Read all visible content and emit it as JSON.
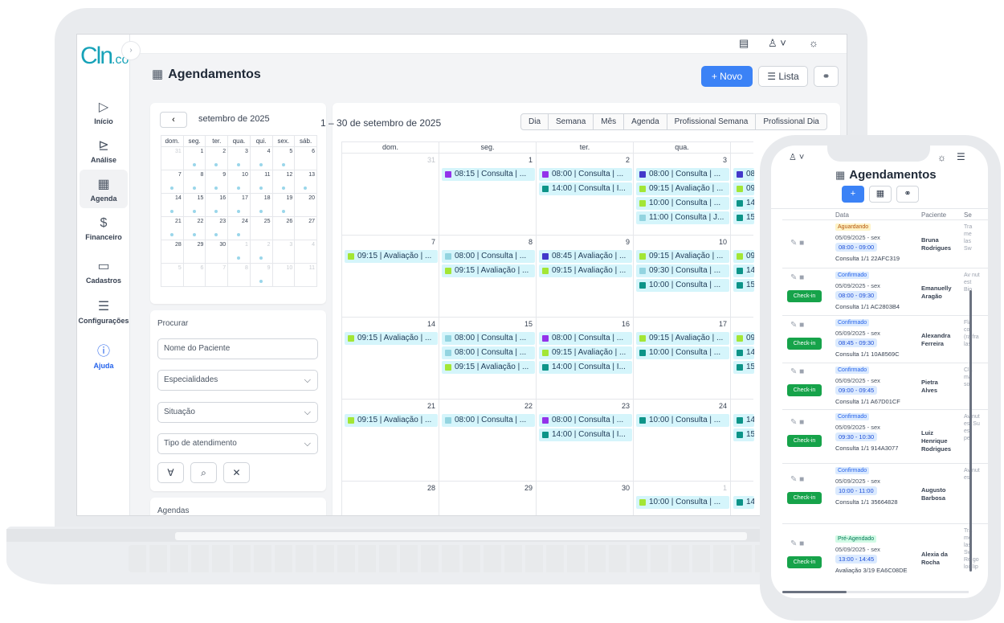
{
  "app": {
    "logo_main": "Cln",
    "logo_suffix": ".co",
    "page_title": "Agendamentos"
  },
  "sidebar": {
    "items": [
      {
        "label": "Início",
        "icon": "play-icon"
      },
      {
        "label": "Análise",
        "icon": "chart-icon"
      },
      {
        "label": "Agenda",
        "icon": "calendar-icon"
      },
      {
        "label": "Financeiro",
        "icon": "dollar-icon"
      },
      {
        "label": "Cadastros",
        "icon": "folder-icon"
      },
      {
        "label": "Configurações",
        "icon": "sliders-icon"
      },
      {
        "label": "Ajuda",
        "icon": "help-icon"
      }
    ]
  },
  "toolbar": {
    "new_label": "+ Novo",
    "list_label": "☰ Lista",
    "link_icon": "link-icon"
  },
  "mini_calendar": {
    "month": "setembro de 2025",
    "weekdays": [
      "dom.",
      "seg.",
      "ter.",
      "qua.",
      "qui.",
      "sex.",
      "sáb."
    ]
  },
  "filters": {
    "title": "Procurar",
    "name_placeholder": "Nome do Paciente",
    "specialties": "Especialidades",
    "status": "Situação",
    "service_type": "Tipo de atendimento",
    "next_card_title": "Agendas"
  },
  "calendar": {
    "range": "1 – 30 de setembro de 2025",
    "views": [
      "Dia",
      "Semana",
      "Mês",
      "Agenda",
      "Profissional Semana",
      "Profissional Dia"
    ],
    "columns": [
      "dom.",
      "seg.",
      "ter.",
      "qua."
    ],
    "colors": {
      "teal": "#0d9488",
      "purple": "#9333ea",
      "lime": "#a3e635",
      "lightblue": "#93d4e0",
      "blue": "#4338ca",
      "event_bg": "#d5f5fb"
    }
  },
  "phone": {
    "title": "Agendamentos",
    "columns": {
      "date": "Data",
      "patient": "Paciente",
      "service": "Se"
    },
    "checkin": "Check-in",
    "rows": [
      {
        "status": "Aguardando",
        "kind": "wait",
        "date": "05/09/2025 - sex",
        "time": "08:00 - 09:00",
        "info": "Consulta 1/1 22AFC319",
        "name": "Bruna Rodrigues",
        "service": "Tra me las Sw"
      },
      {
        "status": "Confirmado",
        "kind": "conf",
        "date": "05/09/2025 - sex",
        "time": "08:00 - 09:30",
        "info": "Consulta 1/1 AC2803B4",
        "name": "Emanuelly Aragão",
        "service": "Av nut est Bio"
      },
      {
        "status": "Confirmado",
        "kind": "conf",
        "date": "05/09/2025 - sex",
        "time": "08:45 - 09:30",
        "info": "Consulta 1/1 10A8569C",
        "name": "Alexandra Ferreira",
        "service": "Fla cor (ra fra las"
      },
      {
        "status": "Confirmado",
        "kind": "conf",
        "date": "05/09/2025 - sex",
        "time": "09:00 - 09:45",
        "info": "Consulta 1/1 A67D01CF",
        "name": "Pietra Alves",
        "service": "Cla ma sol"
      },
      {
        "status": "Confirmado",
        "kind": "conf",
        "date": "05/09/2025 - sex",
        "time": "09:30 - 10:30",
        "info": "Consulta 1/1 914A3077",
        "name": "Luiz Henrique Rodrigues",
        "service": "Av nut est Su est per"
      },
      {
        "status": "Confirmado",
        "kind": "conf",
        "date": "05/09/2025 - sex",
        "time": "10:00 - 11:00",
        "info": "Consulta 1/1 35664828",
        "name": "Augusto Barbosa",
        "service": "Av nut est"
      },
      {
        "status": "Pré-Agendado",
        "kind": "pre",
        "date": "05/09/2025 - sex",
        "time": "13:00 - 14:45",
        "info": "Avaliação 3/19 EA6C08DE",
        "name": "Alexia da Rocha",
        "service": "Tra me las Sw Re go loc lip"
      }
    ]
  }
}
